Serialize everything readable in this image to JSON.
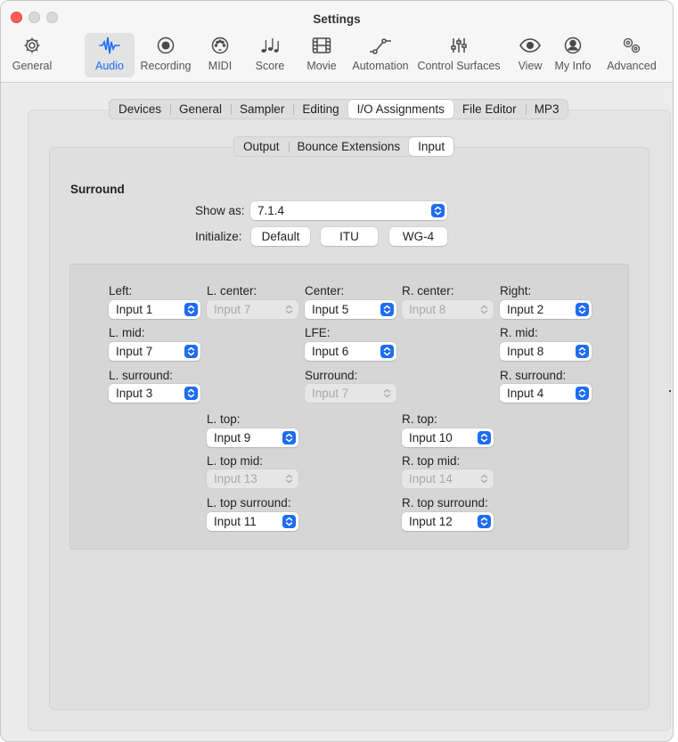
{
  "window": {
    "title": "Settings"
  },
  "toolbar": [
    {
      "label": "General",
      "icon": "gear-icon"
    },
    {
      "label": "Audio",
      "icon": "waveform-icon",
      "active": true
    },
    {
      "label": "Recording",
      "icon": "record-icon"
    },
    {
      "label": "MIDI",
      "icon": "midi-port-icon"
    },
    {
      "label": "Score",
      "icon": "music-notes-icon"
    },
    {
      "label": "Movie",
      "icon": "film-icon"
    },
    {
      "label": "Automation",
      "icon": "automation-curve-icon"
    },
    {
      "label": "Control Surfaces",
      "icon": "faders-icon"
    },
    {
      "label": "View",
      "icon": "eye-icon"
    },
    {
      "label": "My Info",
      "icon": "person-icon"
    },
    {
      "label": "Advanced",
      "icon": "gears-icon"
    }
  ],
  "tabs": [
    "Devices",
    "General",
    "Sampler",
    "Editing",
    "I/O Assignments",
    "File Editor",
    "MP3"
  ],
  "selected_tab": "I/O Assignments",
  "subtabs": [
    "Output",
    "Bounce Extensions",
    "Input"
  ],
  "selected_subtab": "Input",
  "surround": {
    "title": "Surround",
    "show_as_label": "Show as:",
    "show_as_value": "7.1.4",
    "initialize_label": "Initialize:",
    "buttons": {
      "default": "Default",
      "itu": "ITU",
      "wg4": "WG-4"
    }
  },
  "channels": {
    "left": {
      "label": "Left:",
      "value": "Input 1",
      "enabled": true
    },
    "l_center": {
      "label": "L. center:",
      "value": "Input 7",
      "enabled": false
    },
    "center": {
      "label": "Center:",
      "value": "Input 5",
      "enabled": true
    },
    "r_center": {
      "label": "R. center:",
      "value": "Input 8",
      "enabled": false
    },
    "right": {
      "label": "Right:",
      "value": "Input 2",
      "enabled": true
    },
    "l_mid": {
      "label": "L. mid:",
      "value": "Input 7",
      "enabled": true
    },
    "lfe": {
      "label": "LFE:",
      "value": "Input 6",
      "enabled": true
    },
    "r_mid": {
      "label": "R. mid:",
      "value": "Input 8",
      "enabled": true
    },
    "l_surround": {
      "label": "L. surround:",
      "value": "Input 3",
      "enabled": true
    },
    "surround": {
      "label": "Surround:",
      "value": "Input 7",
      "enabled": false
    },
    "r_surround": {
      "label": "R. surround:",
      "value": "Input 4",
      "enabled": true
    },
    "l_top": {
      "label": "L. top:",
      "value": "Input 9",
      "enabled": true
    },
    "r_top": {
      "label": "R. top:",
      "value": "Input 10",
      "enabled": true
    },
    "l_top_mid": {
      "label": "L. top mid:",
      "value": "Input 13",
      "enabled": false
    },
    "r_top_mid": {
      "label": "R. top mid:",
      "value": "Input 14",
      "enabled": false
    },
    "l_top_surround": {
      "label": "L. top surround:",
      "value": "Input 11",
      "enabled": true
    },
    "r_top_surround": {
      "label": "R. top surround:",
      "value": "Input 12",
      "enabled": true
    }
  },
  "colors": {
    "accent": "#1d6cf2",
    "close": "#fe5f57"
  }
}
